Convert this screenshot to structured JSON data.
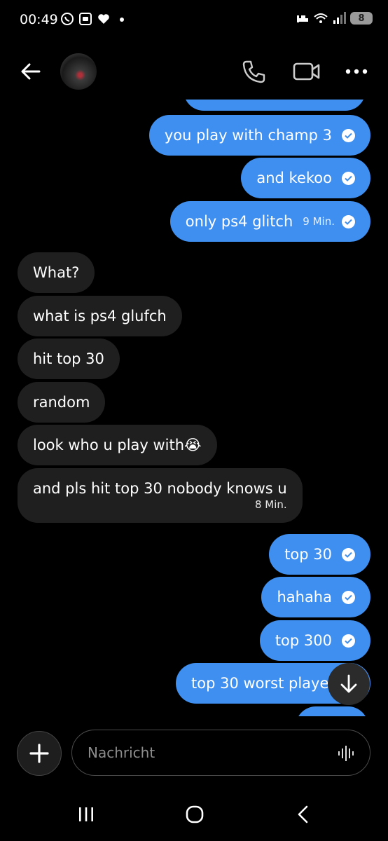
{
  "status_bar": {
    "time": "00:49",
    "battery": "8",
    "icons_left": [
      "whatsapp-icon",
      "screenshot-icon",
      "heart-icon",
      "dot-icon"
    ],
    "icons_right": [
      "sleep-icon",
      "wifi-5-icon",
      "signal-icon",
      "battery-icon"
    ]
  },
  "header": {
    "icons": [
      "back-arrow-icon",
      "avatar",
      "phone-icon",
      "video-icon",
      "more-icon"
    ]
  },
  "messages": [
    {
      "dir": "out",
      "text": "you play with champ 3",
      "status": "read"
    },
    {
      "dir": "out",
      "text": "and kekoo",
      "status": "read"
    },
    {
      "dir": "out",
      "text": "only ps4 glitch",
      "time": "9 Min.",
      "status": "read"
    },
    {
      "dir": "in",
      "text": "What?"
    },
    {
      "dir": "in",
      "text": "what is ps4 glufch"
    },
    {
      "dir": "in",
      "text": "hit top 30"
    },
    {
      "dir": "in",
      "text": "random"
    },
    {
      "dir": "in",
      "text": "look who u play with😭"
    },
    {
      "dir": "in",
      "text": "and pls hit top 30 nobody knows u",
      "time": "8 Min."
    },
    {
      "dir": "out",
      "text": "top 30",
      "status": "read"
    },
    {
      "dir": "out",
      "text": "hahaha",
      "status": "read"
    },
    {
      "dir": "out",
      "text": "top 300",
      "status": "read"
    },
    {
      "dir": "out",
      "text": "top 30 worst playe"
    }
  ],
  "composer": {
    "placeholder": "Nachricht",
    "icons": [
      "plus-icon",
      "voice-wave-icon"
    ]
  },
  "colors": {
    "outgoing": "#3f8ff0",
    "incoming": "#1f1f1f",
    "background": "#000000"
  }
}
